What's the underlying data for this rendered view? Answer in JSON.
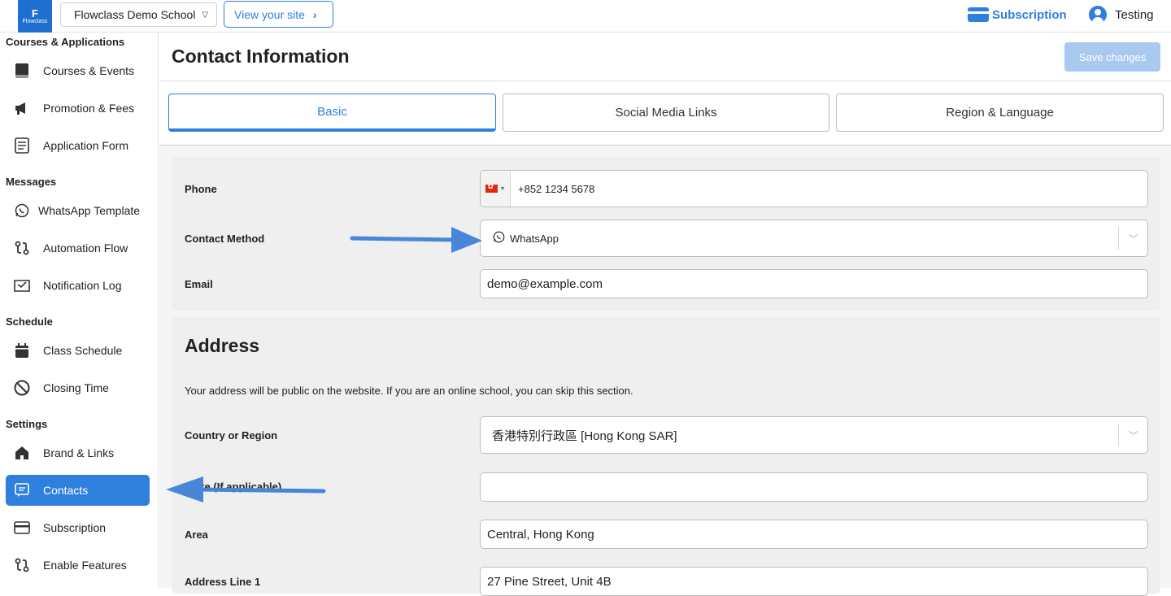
{
  "header": {
    "logo_text": "Flowclass",
    "school_name": "Flowclass Demo School",
    "view_site_label": "View your site",
    "subscription_label": "Subscription",
    "user_name": "Testing"
  },
  "sidebar": {
    "sections": [
      {
        "title": "Courses & Applications",
        "items": [
          {
            "label": "Courses & Events",
            "icon": "book-icon"
          },
          {
            "label": "Promotion & Fees",
            "icon": "megaphone-icon"
          },
          {
            "label": "Application Form",
            "icon": "form-icon"
          }
        ]
      },
      {
        "title": "Messages",
        "items": [
          {
            "label": "WhatsApp Template",
            "icon": "whatsapp-icon"
          },
          {
            "label": "Automation Flow",
            "icon": "flow-icon"
          },
          {
            "label": "Notification Log",
            "icon": "inbox-icon"
          }
        ]
      },
      {
        "title": "Schedule",
        "items": [
          {
            "label": "Class Schedule",
            "icon": "calendar-icon"
          },
          {
            "label": "Closing Time",
            "icon": "ban-icon"
          }
        ]
      },
      {
        "title": "Settings",
        "items": [
          {
            "label": "Brand & Links",
            "icon": "home-icon"
          },
          {
            "label": "Contacts",
            "icon": "contact-icon",
            "active": true
          },
          {
            "label": "Subscription",
            "icon": "card-icon"
          },
          {
            "label": "Enable Features",
            "icon": "flow-icon"
          }
        ]
      }
    ]
  },
  "main": {
    "title": "Contact Information",
    "save_label": "Save changes",
    "tabs": [
      "Basic",
      "Social Media Links",
      "Region & Language"
    ],
    "active_tab": "Basic",
    "basic": {
      "phone_label": "Phone",
      "phone_value": "+852 1234 5678",
      "contact_method_label": "Contact Method",
      "contact_method_value": "WhatsApp",
      "email_label": "Email",
      "email_value": "demo@example.com"
    },
    "address": {
      "title": "Address",
      "description": "Your address will be public on the website. If you are an online school, you can skip this section.",
      "country_label": "Country or Region",
      "country_value": "香港特別行政區 [Hong Kong SAR]",
      "state_label": "State (If applicable)",
      "state_value": "",
      "area_label": "Area",
      "area_value": "Central, Hong Kong",
      "address1_label": "Address Line 1",
      "address1_value": "27 Pine Street, Unit 4B"
    }
  },
  "colors": {
    "accent": "#2f7fdc",
    "save_disabled": "#a9c9ef",
    "panel_bg": "#efefef",
    "annotation_arrow": "#4a86d8"
  }
}
